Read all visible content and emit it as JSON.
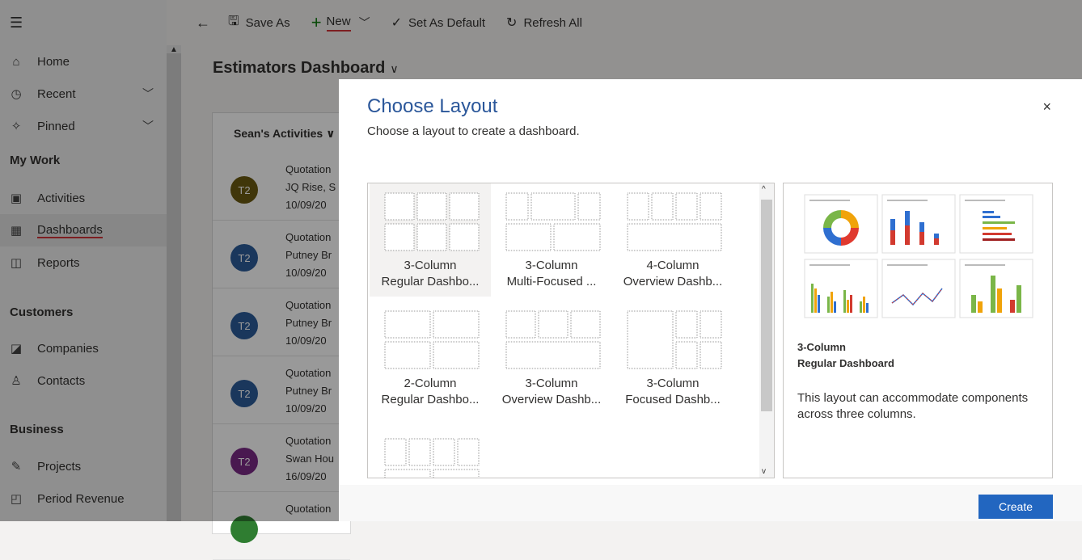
{
  "toolbar": {
    "back_icon": "←",
    "save_as": "Save As",
    "new_label": "New",
    "set_default": "Set As Default",
    "refresh_all": "Refresh All"
  },
  "sidebar": {
    "home": "Home",
    "recent": "Recent",
    "pinned": "Pinned",
    "my_work": "My Work",
    "activities": "Activities",
    "dashboards": "Dashboards",
    "reports": "Reports",
    "customers": "Customers",
    "companies": "Companies",
    "contacts": "Contacts",
    "business": "Business",
    "projects": "Projects",
    "period_revenue": "Period Revenue"
  },
  "dashboard": {
    "title": "Estimators Dashboard",
    "panel_title": "Sean's Activities",
    "activities": [
      {
        "initials": "T2",
        "color": "#6b5a12",
        "l1": "Quotation",
        "l2": "JQ Rise, S",
        "l3": "10/09/20"
      },
      {
        "initials": "T2",
        "color": "#2c5d99",
        "l1": "Quotation",
        "l2": "Putney Br",
        "l3": "10/09/20"
      },
      {
        "initials": "T2",
        "color": "#2c5d99",
        "l1": "Quotation",
        "l2": "Putney Br",
        "l3": "10/09/20"
      },
      {
        "initials": "T2",
        "color": "#2c5d99",
        "l1": "Quotation",
        "l2": "Putney Br",
        "l3": "10/09/20"
      },
      {
        "initials": "T2",
        "color": "#7a2a86",
        "l1": "Quotation",
        "l2": "Swan Hou",
        "l3": "16/09/20"
      },
      {
        "initials": "",
        "color": "#2f7d31",
        "l1": "Quotation",
        "l2": "",
        "l3": ""
      }
    ]
  },
  "dialog": {
    "title": "Choose Layout",
    "subtitle": "Choose a layout to create a dashboard.",
    "close": "×",
    "layouts": [
      {
        "line1": "3-Column",
        "line2": "Regular Dashbo..."
      },
      {
        "line1": "3-Column",
        "line2": "Multi-Focused ..."
      },
      {
        "line1": "4-Column",
        "line2": "Overview Dashb..."
      },
      {
        "line1": "2-Column",
        "line2": "Regular Dashbo..."
      },
      {
        "line1": "3-Column",
        "line2": "Overview Dashb..."
      },
      {
        "line1": "3-Column",
        "line2": "Focused Dashb..."
      }
    ],
    "preview_name_1": "3-Column",
    "preview_name_2": "Regular Dashboard",
    "preview_desc": "This layout can accommodate components across three columns.",
    "create": "Create"
  },
  "colors": {
    "accent": "#2266c0",
    "title_blue": "#2b579a",
    "new_green": "#107c10",
    "underline_red": "#d13438"
  }
}
